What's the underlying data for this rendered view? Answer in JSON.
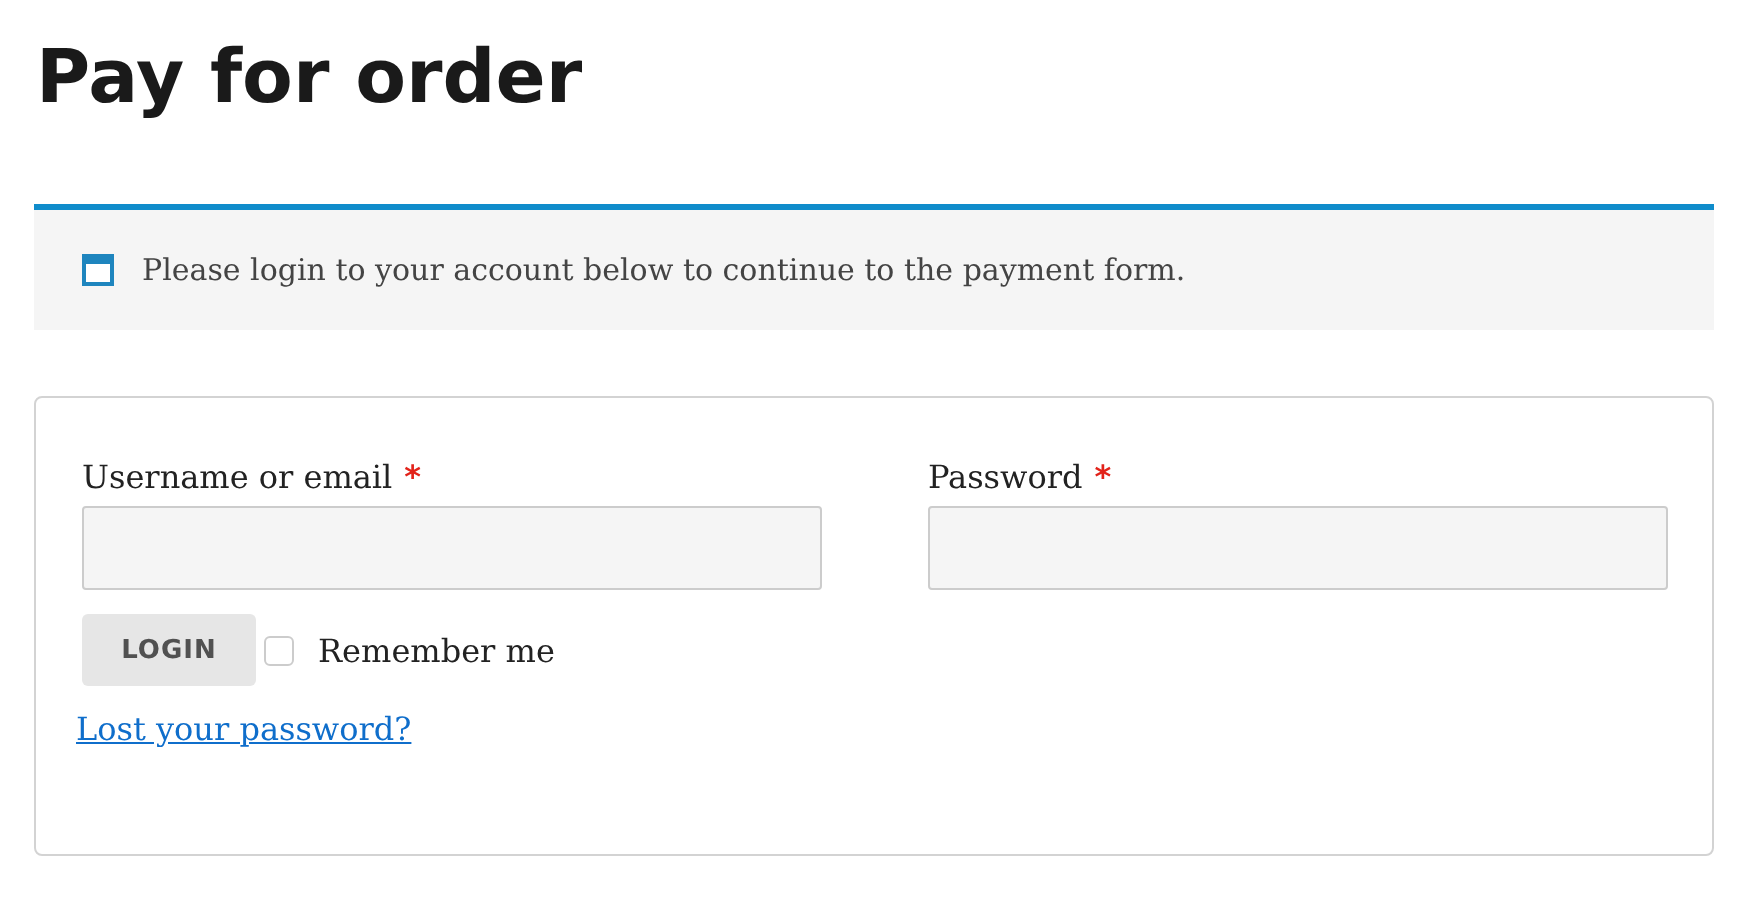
{
  "page_title": "Pay for order",
  "notice": {
    "text": "Please login to your account below to continue to the payment form."
  },
  "login_form": {
    "fields": [
      {
        "label": "Username or email",
        "required_mark": "*"
      },
      {
        "label": "Password",
        "required_mark": "*"
      }
    ],
    "login_button": "LOGIN",
    "remember_me": {
      "label": "Remember me",
      "checked": false
    },
    "lost_password_link": "Lost your password?"
  }
}
